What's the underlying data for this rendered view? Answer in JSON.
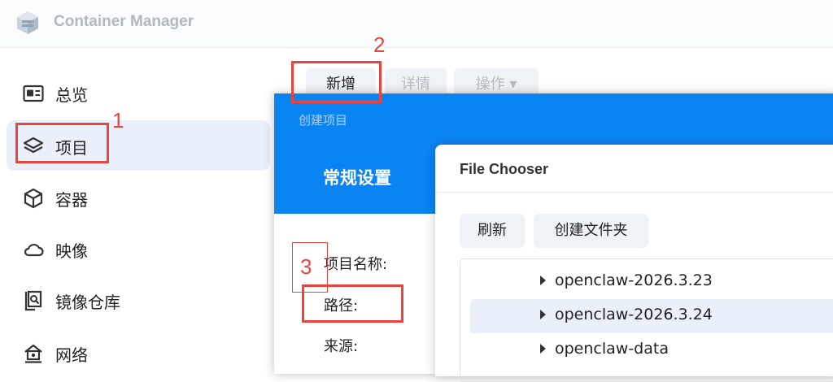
{
  "app": {
    "title": "Container Manager"
  },
  "sidebar": {
    "items": [
      {
        "label": "总览",
        "icon": "overview-card-icon"
      },
      {
        "label": "项目",
        "icon": "layers-icon",
        "active": true
      },
      {
        "label": "容器",
        "icon": "cube-icon"
      },
      {
        "label": "映像",
        "icon": "cloud-icon"
      },
      {
        "label": "镜像仓库",
        "icon": "registry-search-icon"
      },
      {
        "label": "网络",
        "icon": "network-icon"
      }
    ]
  },
  "toolbar": {
    "new_label": "新增",
    "detail_label": "详情",
    "action_label": "操作 ▾"
  },
  "dialog": {
    "title": "创建项目",
    "tab": "常规设置",
    "fields": {
      "name_label": "项目名称:",
      "path_label": "路径:",
      "source_label": "来源:"
    }
  },
  "chooser": {
    "title": "File Chooser",
    "refresh_label": "刷新",
    "create_folder_label": "创建文件夹",
    "items": [
      {
        "label": "openclaw-2026.3.23",
        "selected": false
      },
      {
        "label": "openclaw-2026.3.24",
        "selected": true
      },
      {
        "label": "openclaw-data",
        "selected": false
      }
    ]
  },
  "annotations": {
    "step1": "1",
    "step2": "2",
    "step3": "3"
  },
  "colors": {
    "accent": "#0b84f3",
    "annotation": "#e8453f",
    "active_bg": "#eaf0fa"
  }
}
